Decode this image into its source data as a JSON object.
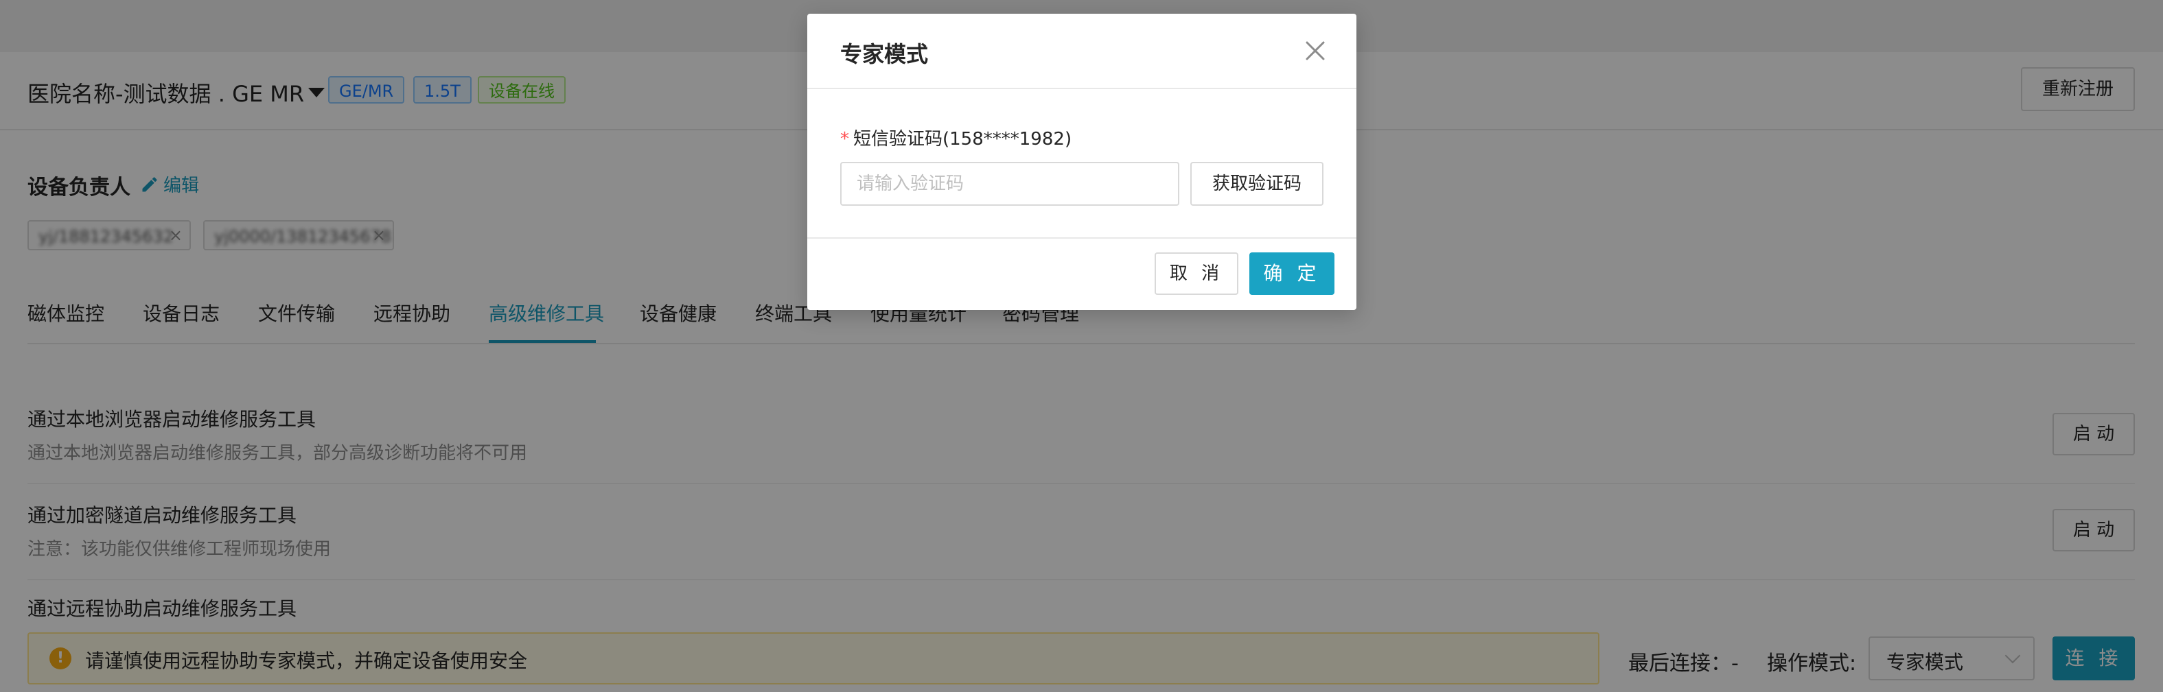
{
  "header": {
    "device_title": "医院名称-测试数据 . GE MR",
    "tags": [
      "GE/MR",
      "1.5T"
    ],
    "status_tag": "设备在线",
    "reregister_label": "重新注册"
  },
  "owners": {
    "title": "设备负责人",
    "edit_label": "编辑",
    "chips": [
      "yj/18812345632",
      "yj0000/13812345678"
    ]
  },
  "tabs": {
    "items": [
      "磁体监控",
      "设备日志",
      "文件传输",
      "远程协助",
      "高级维修工具",
      "设备健康",
      "终端工具",
      "使用量统计",
      "密码管理"
    ],
    "active": "高级维修工具"
  },
  "tools": {
    "items": [
      {
        "title": "通过本地浏览器启动维修服务工具",
        "desc": "通过本地浏览器启动维修服务工具，部分高级诊断功能将不可用",
        "button": "启 动"
      },
      {
        "title": "通过加密隧道启动维修服务工具",
        "desc": "注意：该功能仅供维修工程师现场使用",
        "button": "启 动"
      },
      {
        "title": "通过远程协助启动维修服务工具"
      }
    ]
  },
  "bottom": {
    "warning": "请谨慎使用远程协助专家模式，并确定设备使用安全",
    "last_connect_label": "最后连接：-",
    "mode_label": "操作模式:",
    "mode_value": "专家模式",
    "connect_label": "连 接"
  },
  "modal": {
    "title": "专家模式",
    "field_label": "短信验证码(158****1982)",
    "input_placeholder": "请输入验证码",
    "input_value": "",
    "get_code_label": "获取验证码",
    "cancel_label": "取 消",
    "ok_label": "确 定"
  },
  "colors": {
    "accent": "#1aa3c4",
    "link": "#1a9bbd",
    "required": "#ff4d4f",
    "warning_icon": "#faad14",
    "tag_blue": "#1677ff",
    "tag_green": "#52c41a"
  },
  "icons": [
    "caret-down-icon",
    "edit-icon",
    "close-icon",
    "warning-icon",
    "chevron-down-icon"
  ]
}
